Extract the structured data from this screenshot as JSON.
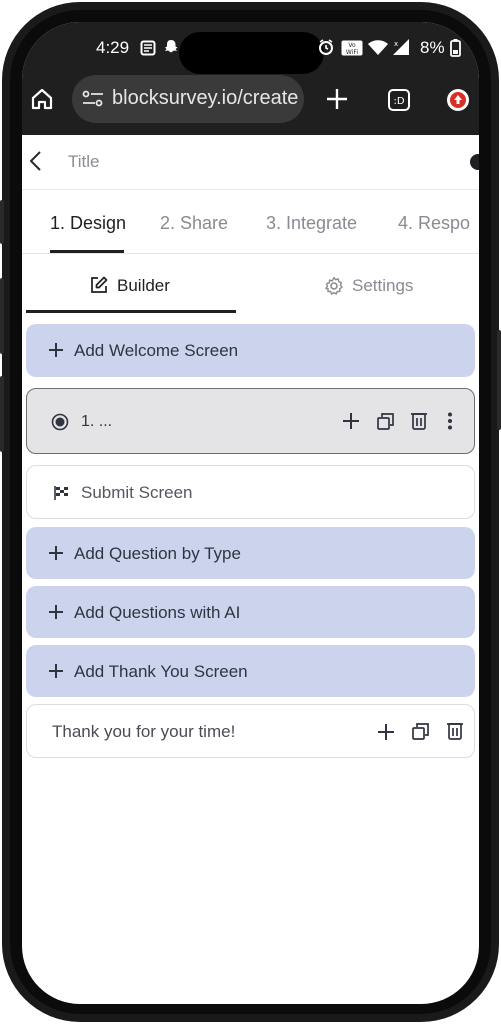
{
  "status_bar": {
    "time": "4:29",
    "battery": "8%"
  },
  "browser": {
    "url": "blocksurvey.io/create",
    "tab_count_label": ":D"
  },
  "header": {
    "title_placeholder": "Title"
  },
  "steps": [
    {
      "label": "1. Design",
      "active": true
    },
    {
      "label": "2. Share",
      "active": false
    },
    {
      "label": "3. Integrate",
      "active": false
    },
    {
      "label": "4. Respo",
      "active": false
    }
  ],
  "subtabs": {
    "builder": "Builder",
    "settings": "Settings"
  },
  "builder": {
    "add_welcome": "Add Welcome Screen",
    "question_1": "1. ...",
    "submit_screen": "Submit Screen",
    "add_question_type": "Add Question by Type",
    "add_questions_ai": "Add Questions with AI",
    "add_thank_you": "Add Thank You Screen",
    "thank_you_text": "Thank you for your time!"
  },
  "colors": {
    "accent_blue": "#ccd4ed",
    "dark_chrome": "#1f1f1f",
    "text_primary": "#1f1f24",
    "text_muted": "#8a8a92"
  }
}
